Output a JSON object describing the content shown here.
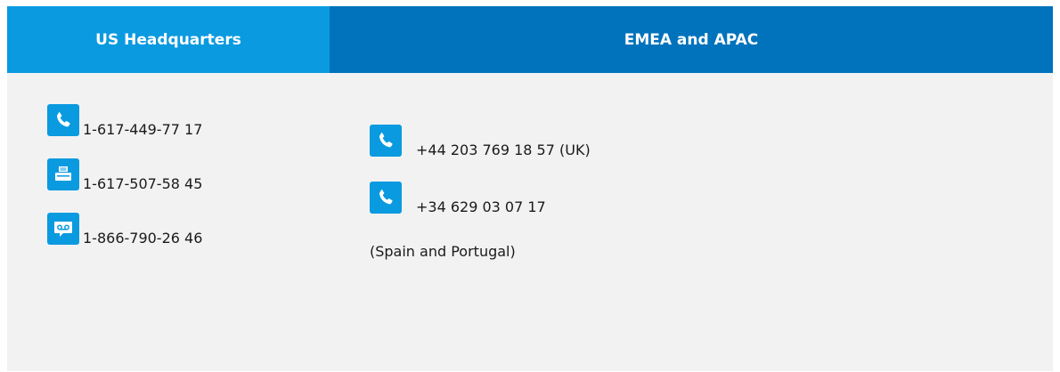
{
  "colors": {
    "header_us": "#0a9ae0",
    "header_emea": "#0073bc",
    "icon_bg": "#0a9ae0",
    "cell_bg": "#f2f2f2"
  },
  "headers": {
    "us": "US Headquarters",
    "emea": "EMEA and APAC"
  },
  "us": {
    "items": [
      {
        "icon": "phone-icon",
        "text": "1-617-449-77 17"
      },
      {
        "icon": "fax-icon",
        "text": "1-617-507-58 45"
      },
      {
        "icon": "voicemail-icon",
        "text": "1-866-790-26 46"
      }
    ]
  },
  "emea": {
    "items": [
      {
        "icon": "phone-icon",
        "text": "+44 203 769 18 57 (UK)"
      },
      {
        "icon": "phone-icon",
        "text": "+34 629 03 07 17"
      }
    ],
    "note": "(Spain and Portugal)"
  }
}
